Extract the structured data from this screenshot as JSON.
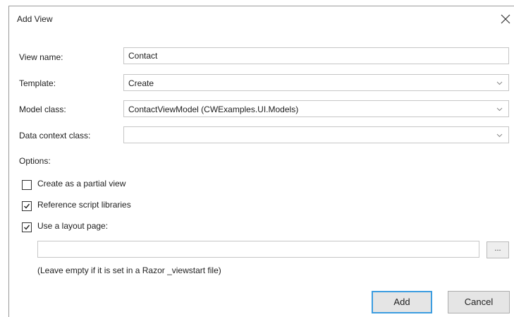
{
  "dialog": {
    "title": "Add View",
    "close_icon": "close-icon"
  },
  "form": {
    "view_name": {
      "label": "View name:",
      "value": "Contact"
    },
    "template": {
      "label": "Template:",
      "value": "Create"
    },
    "model_class": {
      "label": "Model class:",
      "value": "ContactViewModel (CWExamples.UI.Models)"
    },
    "data_context_class": {
      "label": "Data context class:",
      "value": ""
    }
  },
  "options": {
    "heading": "Options:",
    "partial_view": {
      "label": "Create as a partial view",
      "checked": false
    },
    "reference_scripts": {
      "label": "Reference script libraries",
      "checked": true
    },
    "use_layout": {
      "label": "Use a layout page:",
      "checked": true
    },
    "layout_path": {
      "value": ""
    },
    "browse_label": "...",
    "hint": "(Leave empty if it is set in a Razor _viewstart file)"
  },
  "buttons": {
    "add": "Add",
    "cancel": "Cancel"
  },
  "colors": {
    "accent": "#3c9de0",
    "border": "#c6c6c6",
    "button_bg": "#e5e5e5"
  }
}
